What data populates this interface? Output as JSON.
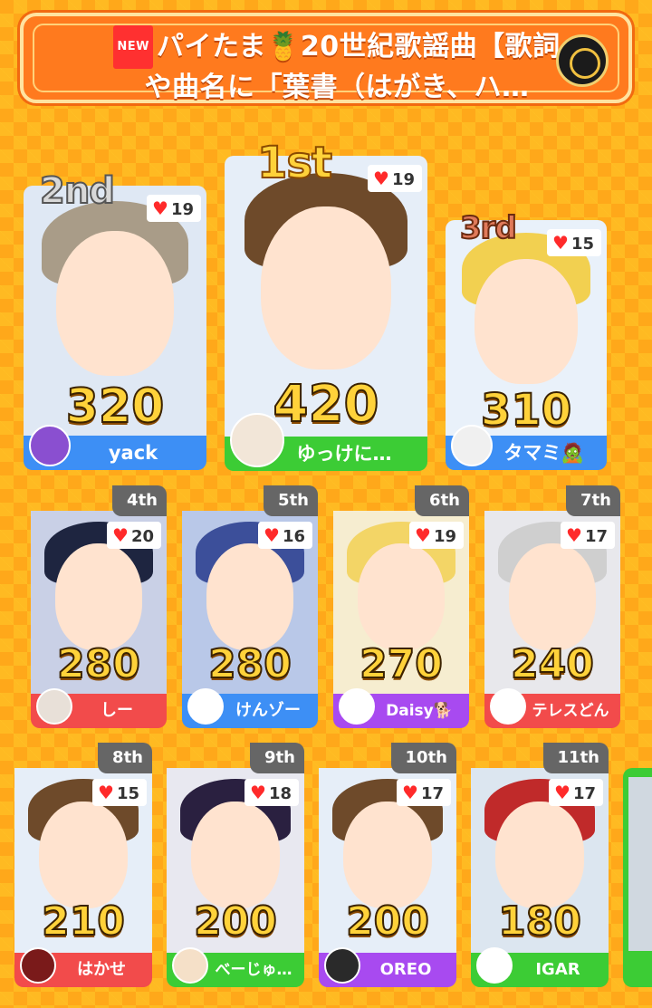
{
  "header": {
    "new_badge": "NEW",
    "title": "パイたま🍍20世紀歌謡曲【歌詞や曲名に「葉書（はがき、ハ…",
    "logo_icon": "crest-icon"
  },
  "podium": [
    {
      "rank": "2nd",
      "likes": "19",
      "score": "320",
      "name": "yack",
      "bg": "#3d8ff5",
      "hair": "#a99c88"
    },
    {
      "rank": "1st",
      "likes": "19",
      "score": "420",
      "name": "ゆっけに…",
      "bg": "#3ccc35",
      "hair": "#6e4a2a"
    },
    {
      "rank": "3rd",
      "likes": "15",
      "score": "310",
      "name": "タマミ🧟",
      "bg": "#3d8ff5",
      "hair": "#f2d050"
    }
  ],
  "row2": [
    {
      "rank": "4th",
      "likes": "20",
      "score": "280",
      "name": "しー",
      "bg": "#f24b4b",
      "hair": "#1e2540"
    },
    {
      "rank": "5th",
      "likes": "16",
      "score": "280",
      "name": "けんゾー",
      "bg": "#3d8ff5",
      "hair": "#3c4f9a"
    },
    {
      "rank": "6th",
      "likes": "19",
      "score": "270",
      "name": "Daisy🐕",
      "bg": "#a84af0",
      "hair": "#f3d566"
    },
    {
      "rank": "7th",
      "likes": "17",
      "score": "240",
      "name": "テレスどん",
      "bg": "#f24b4b",
      "hair": "#cfcfcf"
    }
  ],
  "row3": [
    {
      "rank": "8th",
      "likes": "15",
      "score": "210",
      "name": "はかせ",
      "bg": "#f24b4b",
      "hair": "#6e4a2a"
    },
    {
      "rank": "9th",
      "likes": "18",
      "score": "200",
      "name": "べーじゅ…",
      "bg": "#3ccc35",
      "hair": "#2a2040"
    },
    {
      "rank": "10th",
      "likes": "17",
      "score": "200",
      "name": "OREO",
      "bg": "#a84af0",
      "hair": "#6e4a2a"
    },
    {
      "rank": "11th",
      "likes": "17",
      "score": "180",
      "name": "IGAR",
      "bg": "#3ccc35",
      "hair": "#c02a2a"
    }
  ],
  "colors": {
    "gold": "#ffd23a",
    "silver": "#cccccc",
    "bronze": "#d0704a"
  }
}
